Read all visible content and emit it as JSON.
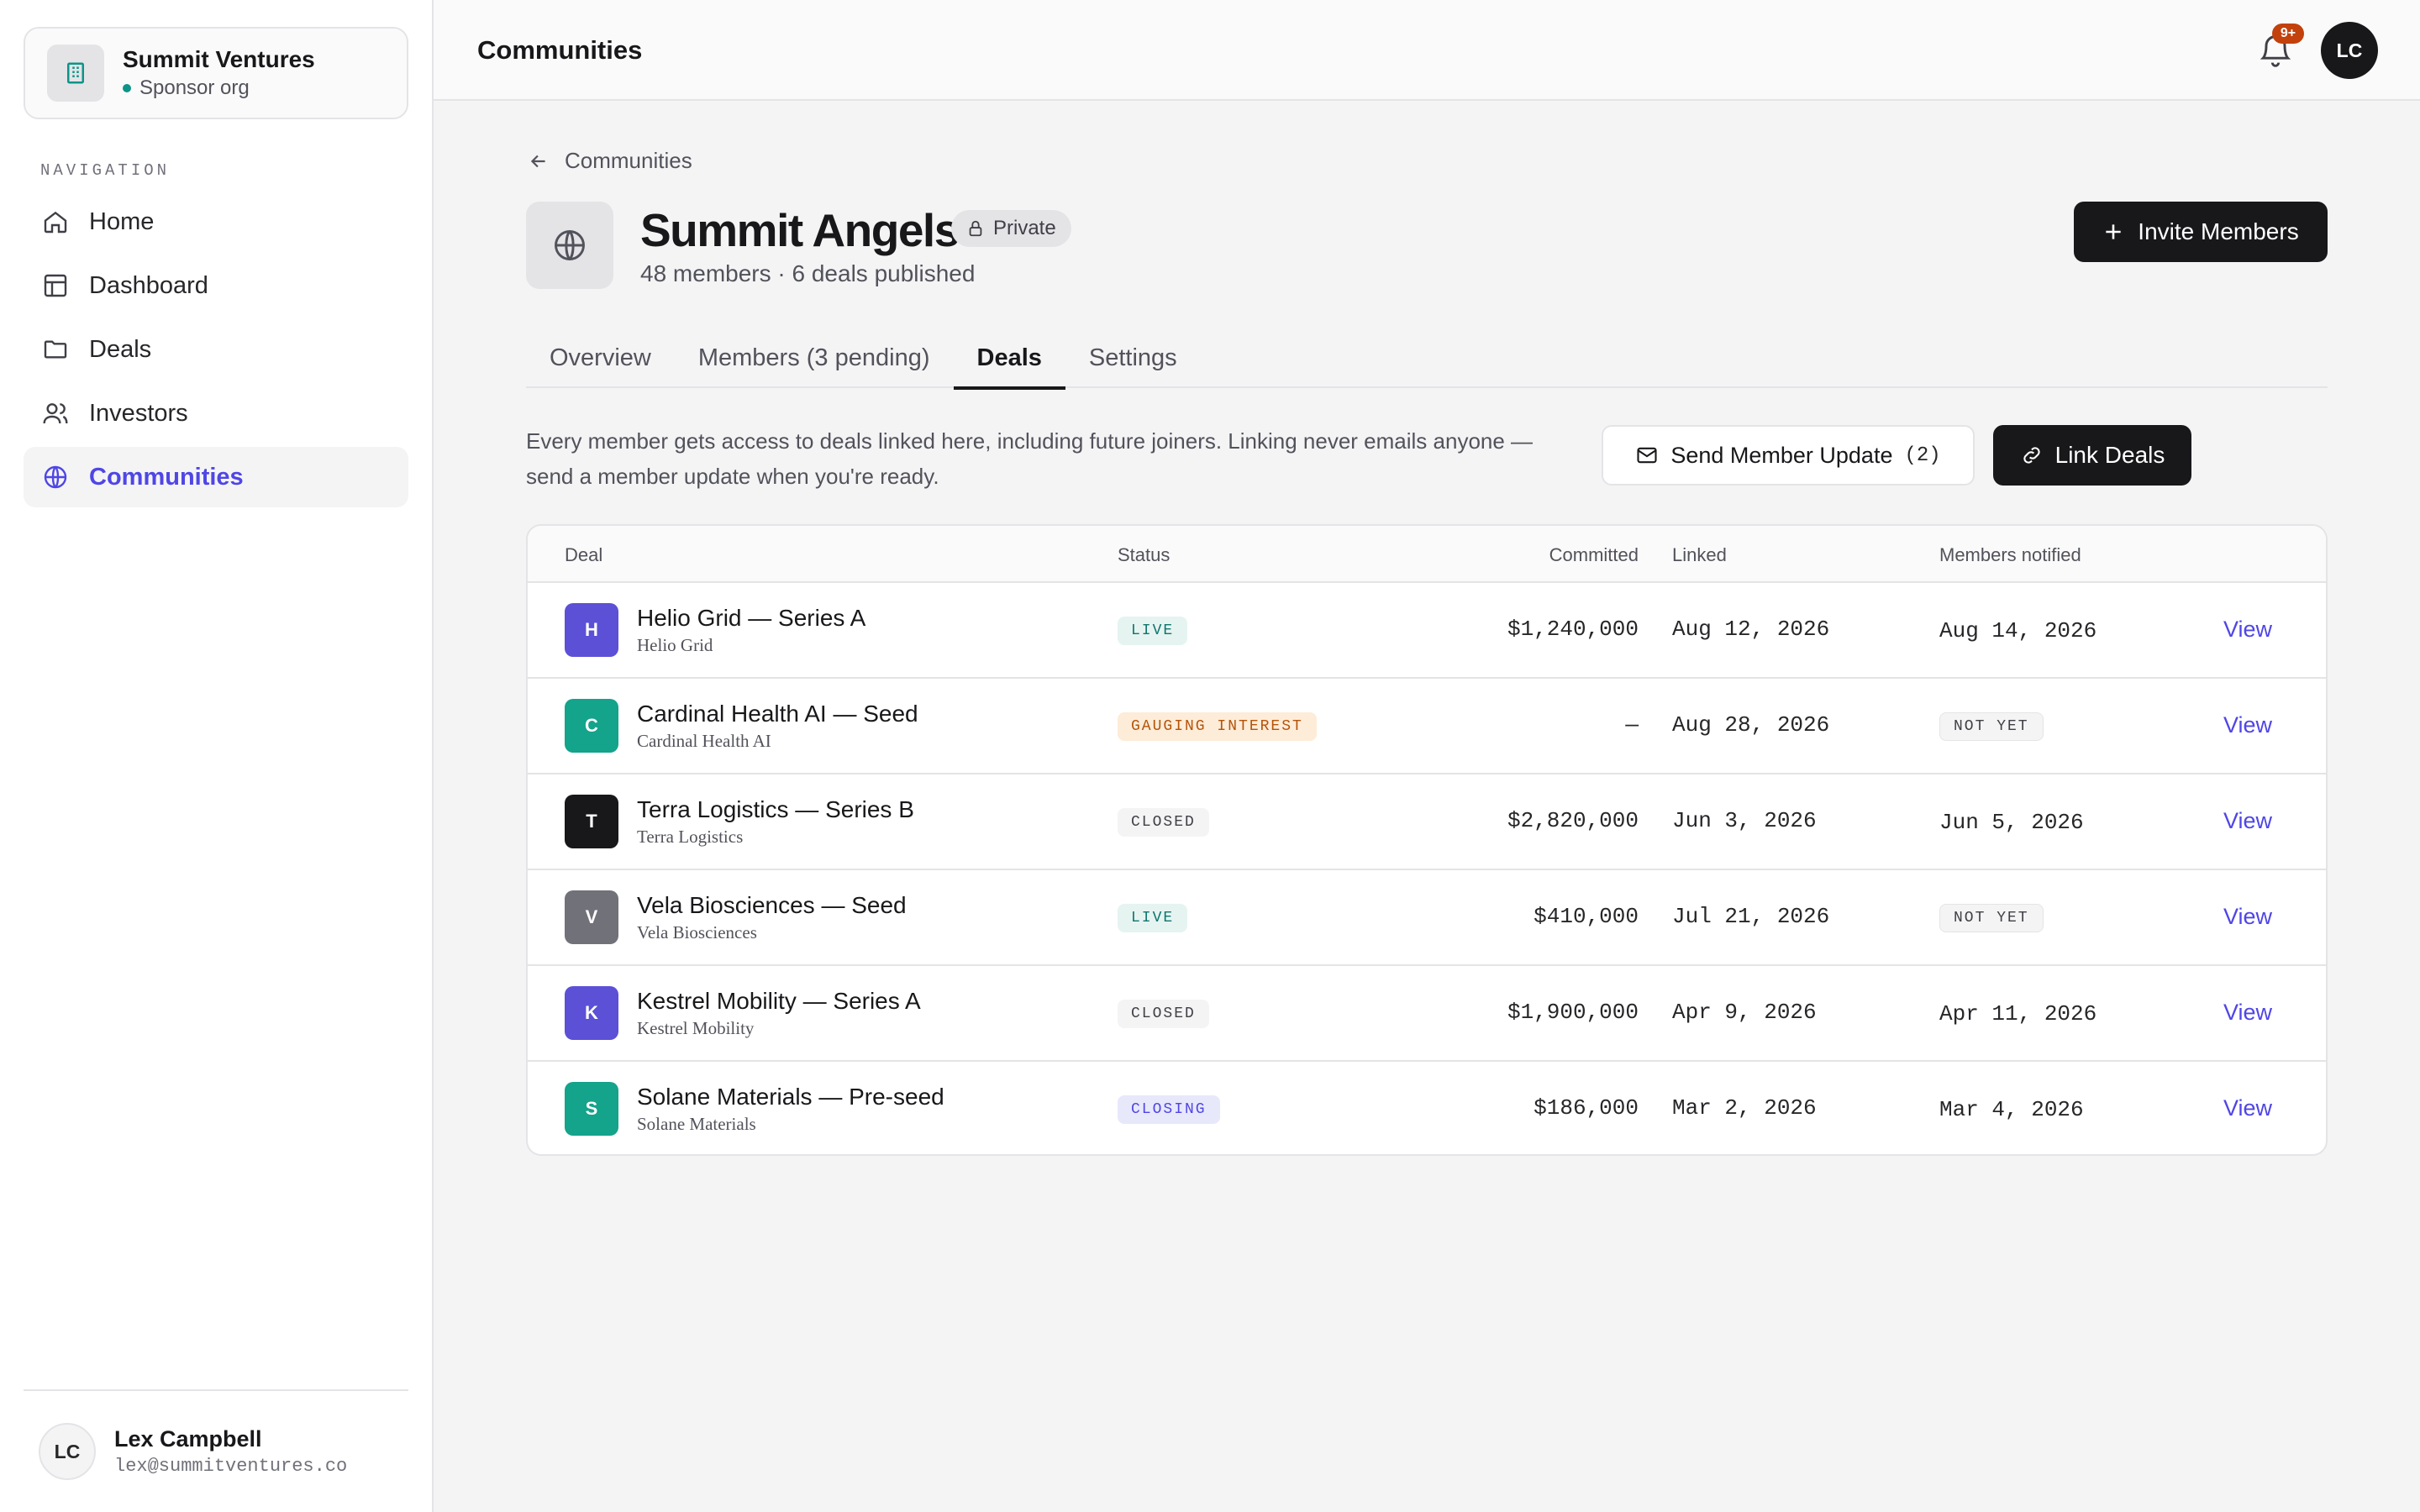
{
  "sidebar": {
    "org": {
      "name": "Summit Ventures",
      "subtitle": "Sponsor org"
    },
    "nav_heading": "NAVIGATION",
    "items": [
      {
        "label": "Home",
        "icon": "home-icon"
      },
      {
        "label": "Dashboard",
        "icon": "dashboard-icon"
      },
      {
        "label": "Deals",
        "icon": "folder-icon"
      },
      {
        "label": "Investors",
        "icon": "users-icon"
      },
      {
        "label": "Communities",
        "icon": "globe-icon",
        "active": true
      }
    ],
    "user": {
      "initials": "LC",
      "name": "Lex Campbell",
      "email": "lex@summitventures.co"
    }
  },
  "topbar": {
    "title": "Communities",
    "notification_badge": "9+",
    "avatar_initials": "LC"
  },
  "page": {
    "breadcrumb": "Communities",
    "community_name": "Summit Angels",
    "privacy_label": "Private",
    "meta": "48 members · 6 deals published",
    "invite_label": "Invite Members",
    "tabs": [
      {
        "label": "Overview"
      },
      {
        "label": "Members (3 pending)"
      },
      {
        "label": "Deals",
        "active": true
      },
      {
        "label": "Settings"
      }
    ],
    "info_text": "Every member gets access to deals linked here, including future joiners. Linking never emails anyone — send a member update when you're ready.",
    "send_update_label": "Send Member Update",
    "send_update_count": "(2)",
    "link_deals_label": "Link Deals"
  },
  "table": {
    "headers": {
      "deal": "Deal",
      "status": "Status",
      "committed": "Committed",
      "linked": "Linked",
      "notified": "Members notified"
    },
    "rows": [
      {
        "initial": "H",
        "avatar_color": "#5b50d6",
        "name": "Helio Grid — Series A",
        "company": "Helio Grid",
        "status": "LIVE",
        "committed": "$1,240,000",
        "linked": "Aug 12, 2026",
        "notified": "Aug 14, 2026",
        "action": "View"
      },
      {
        "initial": "C",
        "avatar_color": "#14a38b",
        "name": "Cardinal Health AI — Seed",
        "company": "Cardinal Health AI",
        "status": "GAUGING INTEREST",
        "committed": "—",
        "linked": "Aug 28, 2026",
        "notified": "NOT YET",
        "action": "View"
      },
      {
        "initial": "T",
        "avatar_color": "#18181b",
        "name": "Terra Logistics — Series B",
        "company": "Terra Logistics",
        "status": "CLOSED",
        "committed": "$2,820,000",
        "linked": "Jun 3, 2026",
        "notified": "Jun 5, 2026",
        "action": "View"
      },
      {
        "initial": "V",
        "avatar_color": "#71717a",
        "name": "Vela Biosciences — Seed",
        "company": "Vela Biosciences",
        "status": "LIVE",
        "committed": "$410,000",
        "linked": "Jul 21, 2026",
        "notified": "NOT YET",
        "action": "View"
      },
      {
        "initial": "K",
        "avatar_color": "#5b50d6",
        "name": "Kestrel Mobility — Series A",
        "company": "Kestrel Mobility",
        "status": "CLOSED",
        "committed": "$1,900,000",
        "linked": "Apr 9, 2026",
        "notified": "Apr 11, 2026",
        "action": "View"
      },
      {
        "initial": "S",
        "avatar_color": "#14a38b",
        "name": "Solane Materials — Pre-seed",
        "company": "Solane Materials",
        "status": "CLOSING",
        "committed": "$186,000",
        "linked": "Mar 2, 2026",
        "notified": "Mar 4, 2026",
        "action": "View"
      }
    ]
  },
  "colors": {
    "accent": "#4f46e5",
    "status_live_bg": "#e6f4f1",
    "status_live_fg": "#0f766e",
    "status_gauging_bg": "#fdecd8",
    "status_gauging_fg": "#b45309",
    "status_closed_bg": "#f4f4f5",
    "status_closed_fg": "#3f3f46",
    "status_closing_bg": "#e8e8fb",
    "status_closing_fg": "#4f46e5"
  }
}
